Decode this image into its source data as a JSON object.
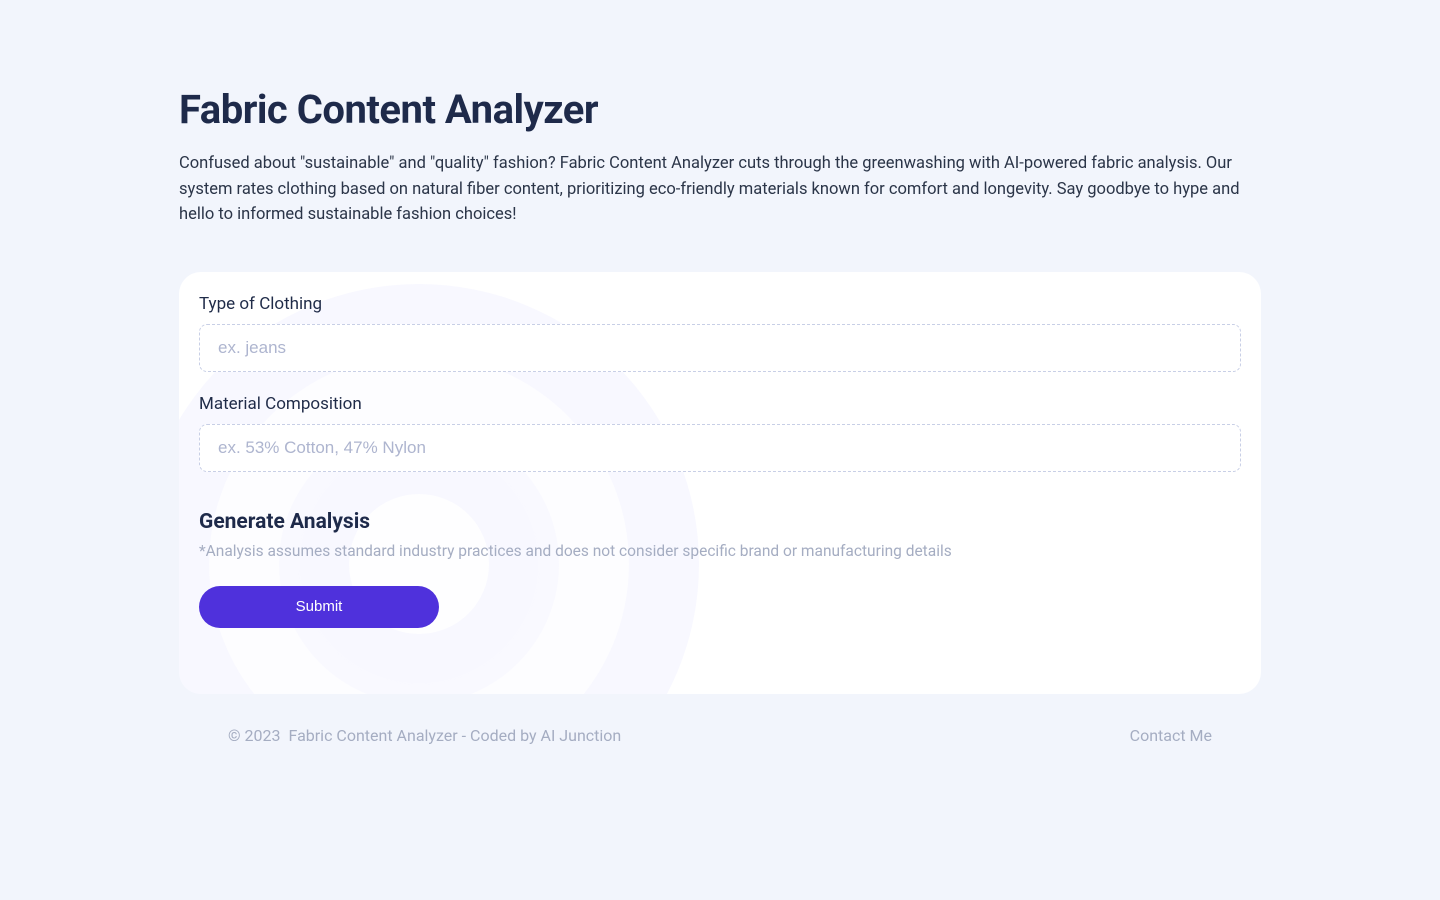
{
  "header": {
    "title": "Fabric Content Analyzer",
    "intro": "Confused about \"sustainable\" and \"quality\" fashion? Fabric Content Analyzer cuts through the greenwashing with AI-powered fabric analysis. Our system rates clothing based on natural fiber content, prioritizing eco-friendly materials known for comfort and longevity. Say goodbye to hype and hello to informed sustainable fashion choices!"
  },
  "form": {
    "clothing": {
      "label": "Type of Clothing",
      "placeholder": "ex. jeans",
      "value": ""
    },
    "material": {
      "label": "Material Composition",
      "placeholder": "ex. 53% Cotton, 47% Nylon",
      "value": ""
    },
    "analysis": {
      "heading": "Generate Analysis",
      "disclaimer": "*Analysis assumes standard industry practices and does not consider specific brand or manufacturing details"
    },
    "submit_label": "Submit"
  },
  "footer": {
    "copyright": "© 2023",
    "credit": "Fabric Content Analyzer - Coded by AI Junction",
    "contact": "Contact Me"
  }
}
